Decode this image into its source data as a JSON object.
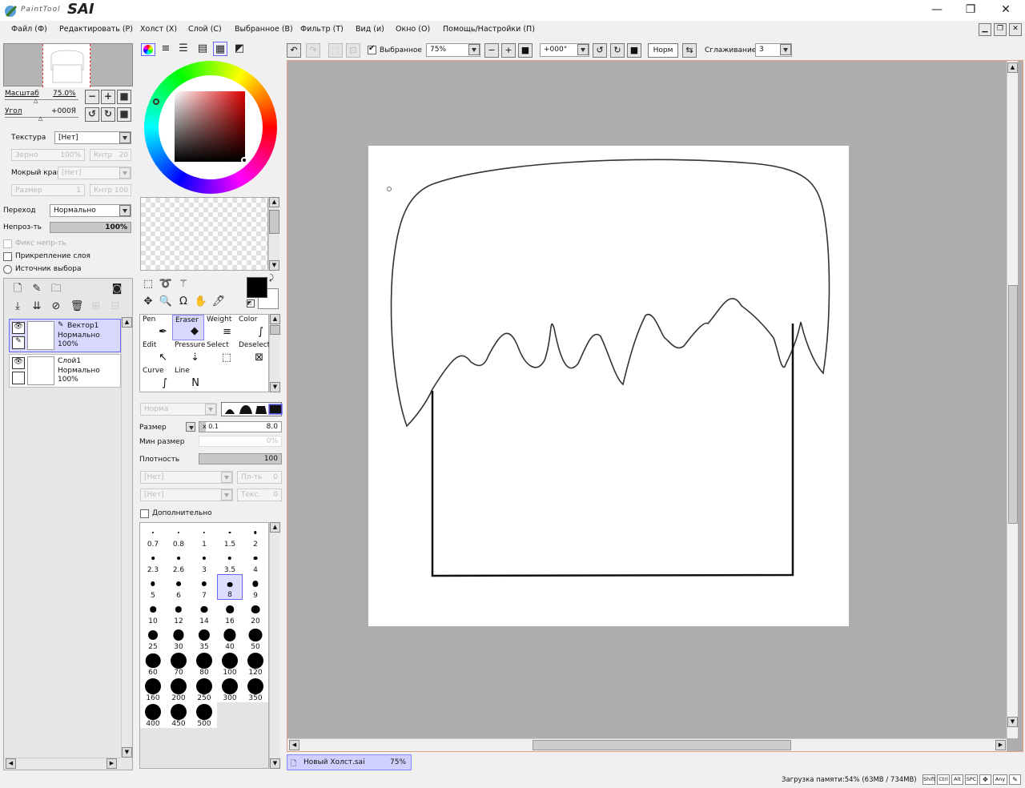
{
  "window": {
    "logo_small": "PaintTool",
    "logo_big": "SAI",
    "minimize": "—",
    "maximize": "❐",
    "close": "✕"
  },
  "menu": [
    "Файл (Ф)",
    "Редактировать (Р)",
    "Холст (Х)",
    "Слой (С)",
    "Выбранное (В)",
    "Фильтр (Т)",
    "Вид (и)",
    "Окно (О)",
    "Помощь/Настройки (П)"
  ],
  "navigator": {
    "scale_label": "Масштаб",
    "scale_value": "75.0%",
    "angle_label": "Угол",
    "angle_value": "+000Я"
  },
  "layer_props": {
    "texture_label": "Текстура",
    "texture_value": "[Нет]",
    "grain_label": "Зерно",
    "grain_value": "100%",
    "contrast_label": "Кнтр",
    "contrast_value": "20",
    "wet_label": "Мокрый край",
    "wet_value": "[Нет]",
    "size_label": "Размер",
    "size_value": "1",
    "contrast2_label": "Кнтр",
    "contrast2_value": "100",
    "blend_label": "Переход",
    "blend_value": "Нормально",
    "opacity_label": "Непроз-ть",
    "opacity_value": "100%",
    "opacity_fraction": 1.0,
    "preserve_opacity": "Фикс непр-ть",
    "clipping": "Прикрепление слоя",
    "selection_source": "Источник выбора"
  },
  "layers": [
    {
      "name": "Вектор1",
      "mode": "Нормально",
      "opacity": "100%",
      "selected": true
    },
    {
      "name": "Слой1",
      "mode": "Нормально",
      "opacity": "100%",
      "selected": false
    }
  ],
  "tools": [
    {
      "name": "Pen",
      "icon": "✒"
    },
    {
      "name": "Eraser",
      "icon": "◆",
      "selected": true
    },
    {
      "name": "Weight",
      "icon": "≡"
    },
    {
      "name": "Color",
      "icon": "∫"
    },
    {
      "name": "Edit",
      "icon": "↖"
    },
    {
      "name": "Pressure",
      "icon": "⇣"
    },
    {
      "name": "Select",
      "icon": "⬚"
    },
    {
      "name": "Deselect",
      "icon": "⊠"
    },
    {
      "name": "Curve",
      "icon": "∫"
    },
    {
      "name": "Line",
      "icon": "N"
    }
  ],
  "brush": {
    "mode_value": "Норма",
    "size_label": "Размер",
    "size_mult": "x 0.1",
    "size_value": "8.0",
    "size_fraction": 0.08,
    "min_size_label": "Мин размер",
    "min_size_value": "0%",
    "density_label": "Плотность",
    "density_value": "100",
    "density_fraction": 1.0,
    "tex1_value": "[Нет]",
    "tex1_side_label": "Пл-ть",
    "tex1_side_value": "0",
    "tex2_value": "[Нет]",
    "tex2_side_label": "Текс.",
    "tex2_side_value": "0",
    "advanced_label": "Дополнительно"
  },
  "brush_sizes": [
    "0.7",
    "0.8",
    "1",
    "1.5",
    "2",
    "2.3",
    "2.6",
    "3",
    "3.5",
    "4",
    "5",
    "6",
    "7",
    "8",
    "9",
    "10",
    "12",
    "14",
    "16",
    "20",
    "25",
    "30",
    "35",
    "40",
    "50",
    "60",
    "70",
    "80",
    "100",
    "120",
    "160",
    "200",
    "250",
    "300",
    "350",
    "400",
    "450",
    "500"
  ],
  "brush_selected": "8",
  "toolbar": {
    "selection_label": "Выбранное",
    "zoom_value": "75%",
    "rotation_value": "+000°",
    "normal_label": "Норм",
    "smoothing_label": "Сглаживание",
    "smoothing_value": "3"
  },
  "tab": {
    "title": "Новый Холст.sai",
    "zoom": "75%"
  },
  "status": {
    "memory": "Загрузка памяти:54% (63MB / 734MB)",
    "keys": [
      "Shift",
      "Ctrl",
      "Alt",
      "SPC",
      "Any"
    ]
  },
  "colors": {
    "primary": "#000000",
    "secondary": "#ffffff",
    "selection": "#d8d8ff",
    "accent_border": "#6a6aff"
  }
}
